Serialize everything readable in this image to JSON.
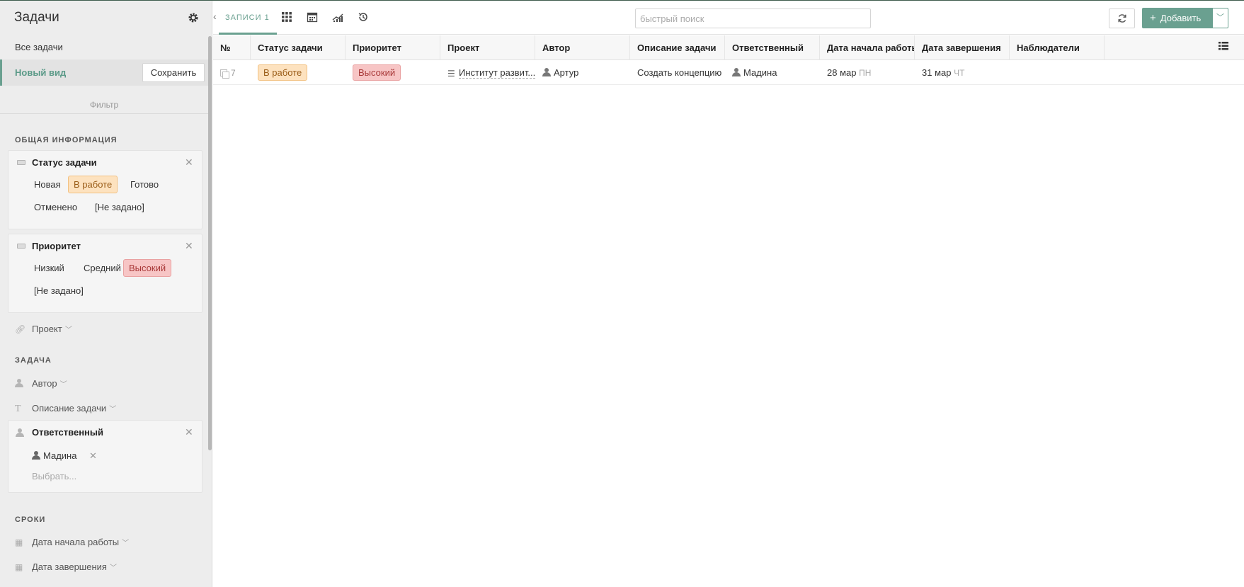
{
  "sidebar": {
    "title": "Задачи",
    "views": {
      "all": "Все задачи",
      "new": "Новый вид",
      "save_label": "Сохранить"
    },
    "filter_label": "Фильтр",
    "section_general": "ОБЩАЯ ИНФОРМАЦИЯ",
    "status_card": {
      "title": "Статус задачи",
      "options": [
        "Новая",
        "В работе",
        "Готово",
        "Отменено",
        "[Не задано]"
      ],
      "selected": "В работе"
    },
    "priority_card": {
      "title": "Приоритет",
      "options": [
        "Низкий",
        "Средний",
        "Высокий",
        "[Не задано]"
      ],
      "selected": "Высокий"
    },
    "project_field": "Проект",
    "section_task": "ЗАДАЧА",
    "author_field": "Автор",
    "description_field": "Описание задачи",
    "assignee_card": {
      "title": "Ответственный",
      "value": "Мадина",
      "choose_placeholder": "Выбрать..."
    },
    "section_dates": "СРОКИ",
    "start_field": "Дата начала работы",
    "end_field": "Дата завершения"
  },
  "toolbar": {
    "records_tab": "ЗАПИСИ 1",
    "search_placeholder": "быстрый поиск",
    "add_label": "Добавить"
  },
  "table": {
    "columns": [
      "№",
      "Статус задачи",
      "Приоритет",
      "Проект",
      "Автор",
      "Описание задачи",
      "Ответственный",
      "Дата начала работы",
      "Дата завершения",
      "Наблюдатели"
    ],
    "rows": [
      {
        "num": "7",
        "status": "В работе",
        "priority": "Высокий",
        "project": "Институт развит...",
        "author": "Артур",
        "description": "Создать концепцию ...",
        "assignee": "Мадина",
        "start_date": "28 мар",
        "start_day": "ПН",
        "end_date": "31 мар",
        "end_day": "ЧТ",
        "watchers": ""
      }
    ]
  },
  "colors": {
    "accent": "#6aa090",
    "status_orange": "#fde2bf",
    "priority_red": "#f7c5c5"
  },
  "icons": [
    "gear-icon",
    "chevron-left-icon",
    "grid-icon",
    "calendar-icon",
    "chart-icon",
    "history-icon",
    "refresh-icon",
    "plus-icon",
    "chevron-down-icon",
    "columns-icon",
    "copy-icon",
    "list-icon",
    "person-icon",
    "close-icon",
    "link-icon",
    "text-icon"
  ]
}
